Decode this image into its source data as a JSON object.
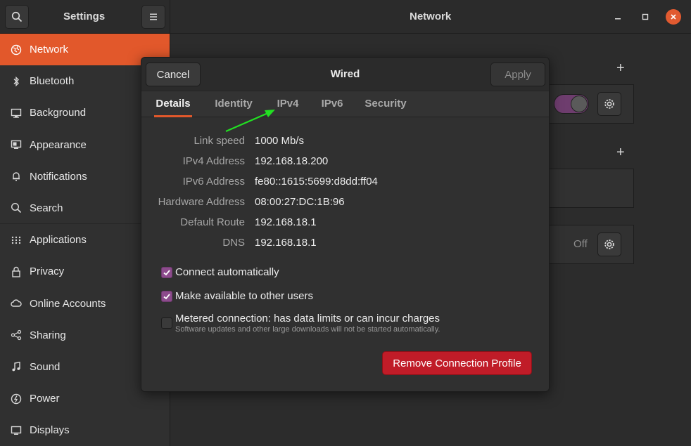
{
  "header": {
    "settings_title": "Settings",
    "panel_title": "Network",
    "icons": [
      "search-icon",
      "menu-icon",
      "minimize-icon",
      "maximize-icon",
      "close-icon"
    ]
  },
  "sidebar": {
    "items": [
      {
        "label": "Network",
        "icon": "network-icon",
        "active": true
      },
      {
        "label": "Bluetooth",
        "icon": "bluetooth-icon"
      },
      {
        "label": "Background",
        "icon": "background-icon"
      },
      {
        "label": "Appearance",
        "icon": "appearance-icon"
      },
      {
        "label": "Notifications",
        "icon": "bell-icon"
      },
      {
        "label": "Search",
        "icon": "search-icon"
      },
      {
        "label": "Applications",
        "icon": "grid-icon"
      },
      {
        "label": "Privacy",
        "icon": "lock-icon"
      },
      {
        "label": "Online Accounts",
        "icon": "cloud-icon"
      },
      {
        "label": "Sharing",
        "icon": "share-icon"
      },
      {
        "label": "Sound",
        "icon": "music-icon"
      },
      {
        "label": "Power",
        "icon": "power-icon"
      },
      {
        "label": "Displays",
        "icon": "display-icon"
      }
    ]
  },
  "background_panel": {
    "vpn_state": "Off"
  },
  "dialog": {
    "title": "Wired",
    "cancel_label": "Cancel",
    "apply_label": "Apply",
    "tabs": [
      "Details",
      "Identity",
      "IPv4",
      "IPv6",
      "Security"
    ],
    "active_tab": "Details",
    "details": [
      {
        "label": "Link speed",
        "value": "1000 Mb/s"
      },
      {
        "label": "IPv4 Address",
        "value": "192.168.18.200"
      },
      {
        "label": "IPv6 Address",
        "value": "fe80::1615:5699:d8dd:ff04"
      },
      {
        "label": "Hardware Address",
        "value": "08:00:27:DC:1B:96"
      },
      {
        "label": "Default Route",
        "value": "192.168.18.1"
      },
      {
        "label": "DNS",
        "value": "192.168.18.1"
      }
    ],
    "options": {
      "connect_auto": {
        "label": "Connect automatically",
        "checked": true
      },
      "available_all": {
        "label": "Make available to other users",
        "checked": true
      },
      "metered": {
        "label": "Metered connection: has data limits or can incur charges",
        "sublabel": "Software updates and other large downloads will not be started automatically.",
        "checked": false
      }
    },
    "remove_label": "Remove Connection Profile"
  },
  "colors": {
    "accent": "#e2582b",
    "toggle_on": "#6e3d6e",
    "checkbox": "#8c4b8c",
    "danger": "#c01c28",
    "annotation_arrow": "#22e022"
  }
}
